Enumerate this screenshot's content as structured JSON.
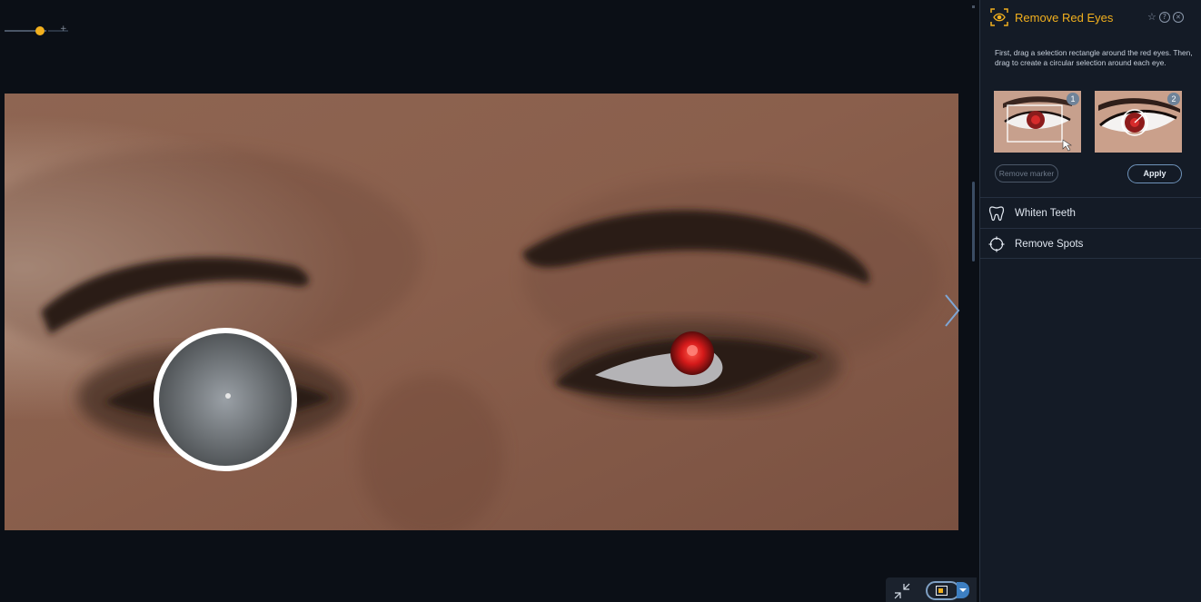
{
  "zoom_slider": {
    "value_fraction": 0.55,
    "plus_glyph": "+"
  },
  "canvas": {
    "next_icon": "chevron-right-icon",
    "fit_icon": "shrink-arrows-icon",
    "compare_icon": "before-after-compare-icon",
    "compare_dropdown_icon": "caret-down-icon"
  },
  "panel": {
    "title": "Remove Red Eyes",
    "title_icon": "red-eye-target-icon",
    "accent_color": "#f2b01e",
    "header_buttons": {
      "favorite_glyph": "☆",
      "help_glyph": "?",
      "close_glyph": "✕"
    },
    "instructions": "First, drag a selection rectangle around the red eyes. Then, drag to create a circular selection around each eye.",
    "step1_badge": "1",
    "step2_badge": "2",
    "remove_marker_label": "Remove marker",
    "apply_label": "Apply",
    "tools": [
      {
        "label": "Whiten Teeth",
        "icon": "tooth-icon"
      },
      {
        "label": "Remove Spots",
        "icon": "crosshair-circle-icon"
      }
    ]
  }
}
